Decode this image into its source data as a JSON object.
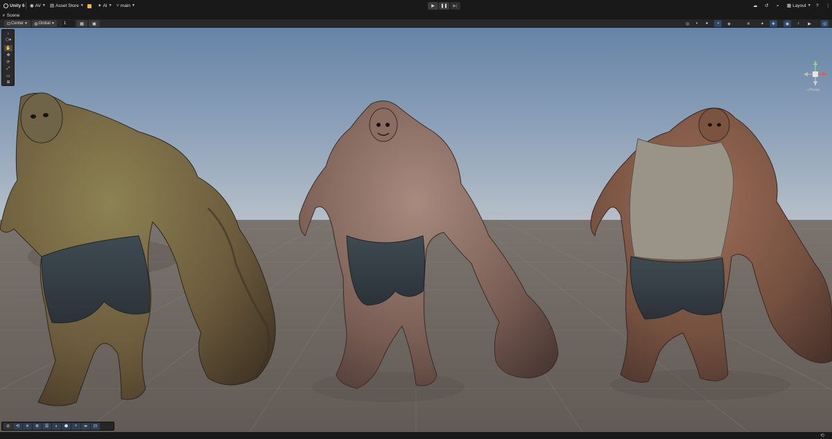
{
  "top_bar": {
    "app_name": "Unity 6",
    "account_label": "AV",
    "asset_store_label": "Asset Store",
    "ai_label": "AI",
    "branch_label": "main",
    "layout_label": "Layout"
  },
  "playback": {
    "play_icon": "play-icon",
    "pause_icon": "pause-icon",
    "step_icon": "step-icon"
  },
  "tab": {
    "label": "Scene"
  },
  "scene_toolbar": {
    "pivot_label": "Center",
    "space_label": "Global",
    "snap_increment": "1"
  },
  "gizmo": {
    "projection_label": "Persp"
  },
  "viewport": {
    "sky_color_top": "#6a86a8",
    "sky_color_horizon": "#a9b8c8",
    "ground_color": "#6e6660"
  },
  "colors": {
    "accent": "#3d7ee0",
    "toolbar_bg": "#282828",
    "chrome_bg": "#191919"
  }
}
